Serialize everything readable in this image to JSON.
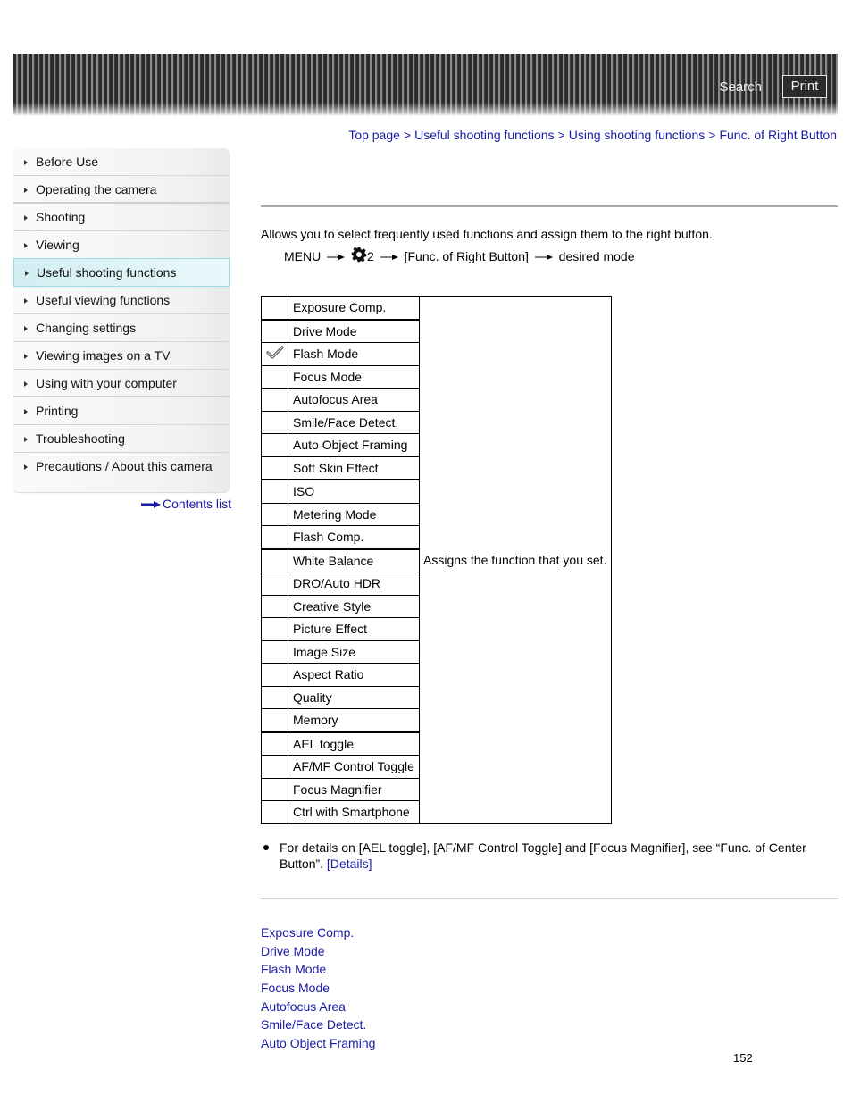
{
  "header": {
    "search_label": "Search",
    "print_label": "Print"
  },
  "breadcrumb": [
    {
      "label": "Top page"
    },
    {
      "label": "Useful shooting functions"
    },
    {
      "label": "Using shooting functions"
    },
    {
      "label": "Func. of Right Button"
    }
  ],
  "breadcrumb_separator": ">",
  "sidebar": {
    "items": [
      {
        "label": "Before Use"
      },
      {
        "label": "Operating the camera"
      },
      {
        "label": "Shooting"
      },
      {
        "label": "Viewing"
      },
      {
        "label": "Useful shooting functions",
        "active": true
      },
      {
        "label": "Useful viewing functions"
      },
      {
        "label": "Changing settings"
      },
      {
        "label": "Viewing images on a TV"
      },
      {
        "label": "Using with your computer"
      },
      {
        "label": "Printing"
      },
      {
        "label": "Troubleshooting"
      },
      {
        "label": "Precautions / About this camera"
      }
    ],
    "contents_link": "Contents list"
  },
  "main": {
    "intro": "Allows you to select frequently used functions and assign them to the right button.",
    "menu_path": {
      "menu": "MENU",
      "settings_tab": "2",
      "item": "[Func. of Right Button]",
      "target": "desired mode"
    },
    "table": {
      "rows": [
        {
          "label": "Exposure Comp.",
          "checked": false
        },
        {
          "label": "Drive Mode",
          "checked": false
        },
        {
          "label": "Flash Mode",
          "checked": true
        },
        {
          "label": "Focus Mode",
          "checked": false
        },
        {
          "label": "Autofocus Area",
          "checked": false
        },
        {
          "label": "Smile/Face Detect.",
          "checked": false
        },
        {
          "label": "Auto Object Framing",
          "checked": false
        },
        {
          "label": "Soft Skin Effect",
          "checked": false
        },
        {
          "label": "ISO",
          "checked": false
        },
        {
          "label": "Metering Mode",
          "checked": false
        },
        {
          "label": "Flash Comp.",
          "checked": false
        },
        {
          "label": "White Balance",
          "checked": false
        },
        {
          "label": "DRO/Auto HDR",
          "checked": false
        },
        {
          "label": "Creative Style",
          "checked": false
        },
        {
          "label": "Picture Effect",
          "checked": false
        },
        {
          "label": "Image Size",
          "checked": false
        },
        {
          "label": "Aspect Ratio",
          "checked": false
        },
        {
          "label": "Quality",
          "checked": false
        },
        {
          "label": "Memory",
          "checked": false
        },
        {
          "label": "AEL toggle",
          "checked": false
        },
        {
          "label": "AF/MF Control Toggle",
          "checked": false
        },
        {
          "label": "Focus Magnifier",
          "checked": false
        },
        {
          "label": "Ctrl with Smartphone",
          "checked": false
        }
      ],
      "description": "Assigns the function that you set."
    },
    "note": {
      "text": "For details on [AEL toggle], [AF/MF Control Toggle] and [Focus Magnifier], see “Func. of Center Button”.",
      "link": "[Details]"
    },
    "related_links": [
      "Exposure Comp.",
      "Drive Mode",
      "Flash Mode",
      "Focus Mode",
      "Autofocus Area",
      "Smile/Face Detect.",
      "Auto Object Framing"
    ],
    "page_number": "152"
  },
  "colors": {
    "link": "#1a1aa8",
    "active_sidebar_bg": "#d2eef3",
    "header_dark": "#2a2a2a"
  }
}
